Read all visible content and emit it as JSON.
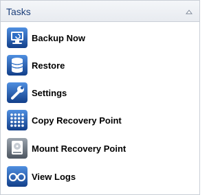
{
  "panel": {
    "title": "Tasks",
    "collapse_icon": "chevron-up-icon"
  },
  "tasks": [
    {
      "label": "Backup Now",
      "icon": "backup-monitor-icon"
    },
    {
      "label": "Restore",
      "icon": "restore-database-icon"
    },
    {
      "label": "Settings",
      "icon": "wrench-icon"
    },
    {
      "label": "Copy Recovery Point",
      "icon": "grid-dots-icon"
    },
    {
      "label": "Mount Recovery Point",
      "icon": "disk-drive-icon"
    },
    {
      "label": "View Logs",
      "icon": "glasses-icon"
    }
  ],
  "colors": {
    "icon_blue": "#1e5fb0",
    "header_text": "#1c3f7a"
  }
}
